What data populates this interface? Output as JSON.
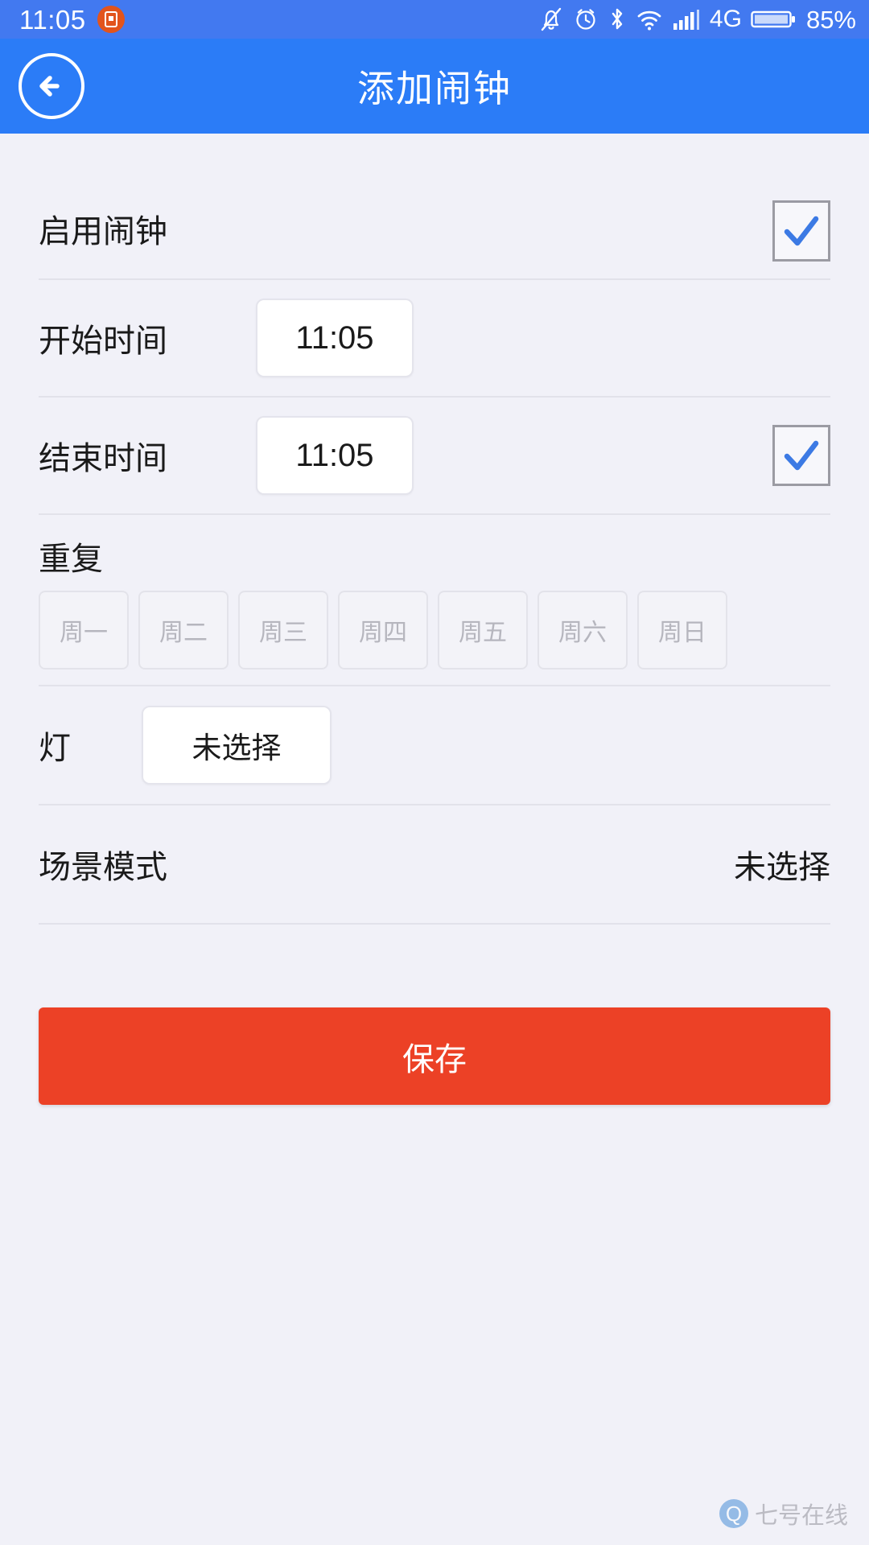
{
  "status_bar": {
    "time": "11:05",
    "notification_icon": "screenshot-icon",
    "icons": [
      "mute-bell-icon",
      "alarm-clock-icon",
      "bluetooth-icon",
      "wifi-icon",
      "signal-bars-icon"
    ],
    "network": "4G",
    "battery_percent": "85%"
  },
  "header": {
    "back_icon": "back-arrow-icon",
    "title": "添加闹钟"
  },
  "form": {
    "enable_alarm": {
      "label": "启用闹钟",
      "checked": true
    },
    "start_time": {
      "label": "开始时间",
      "value": "11:05"
    },
    "end_time": {
      "label": "结束时间",
      "value": "11:05",
      "checked": true
    },
    "repeat": {
      "label": "重复",
      "days": [
        {
          "label": "周一",
          "selected": false
        },
        {
          "label": "周二",
          "selected": false
        },
        {
          "label": "周三",
          "selected": false
        },
        {
          "label": "周四",
          "selected": false
        },
        {
          "label": "周五",
          "selected": false
        },
        {
          "label": "周六",
          "selected": false
        },
        {
          "label": "周日",
          "selected": false
        }
      ]
    },
    "light": {
      "label": "灯",
      "value": "未选择"
    },
    "scene_mode": {
      "label": "场景模式",
      "value": "未选择"
    }
  },
  "save_button": {
    "label": "保存"
  },
  "watermark": {
    "logo": "Q",
    "text": "七号在线"
  },
  "colors": {
    "status_bar": "#4279f0",
    "header": "#2b7cf7",
    "page_bg": "#f1f1f8",
    "accent_check": "#3c7ae4",
    "save_red": "#ec4126"
  }
}
